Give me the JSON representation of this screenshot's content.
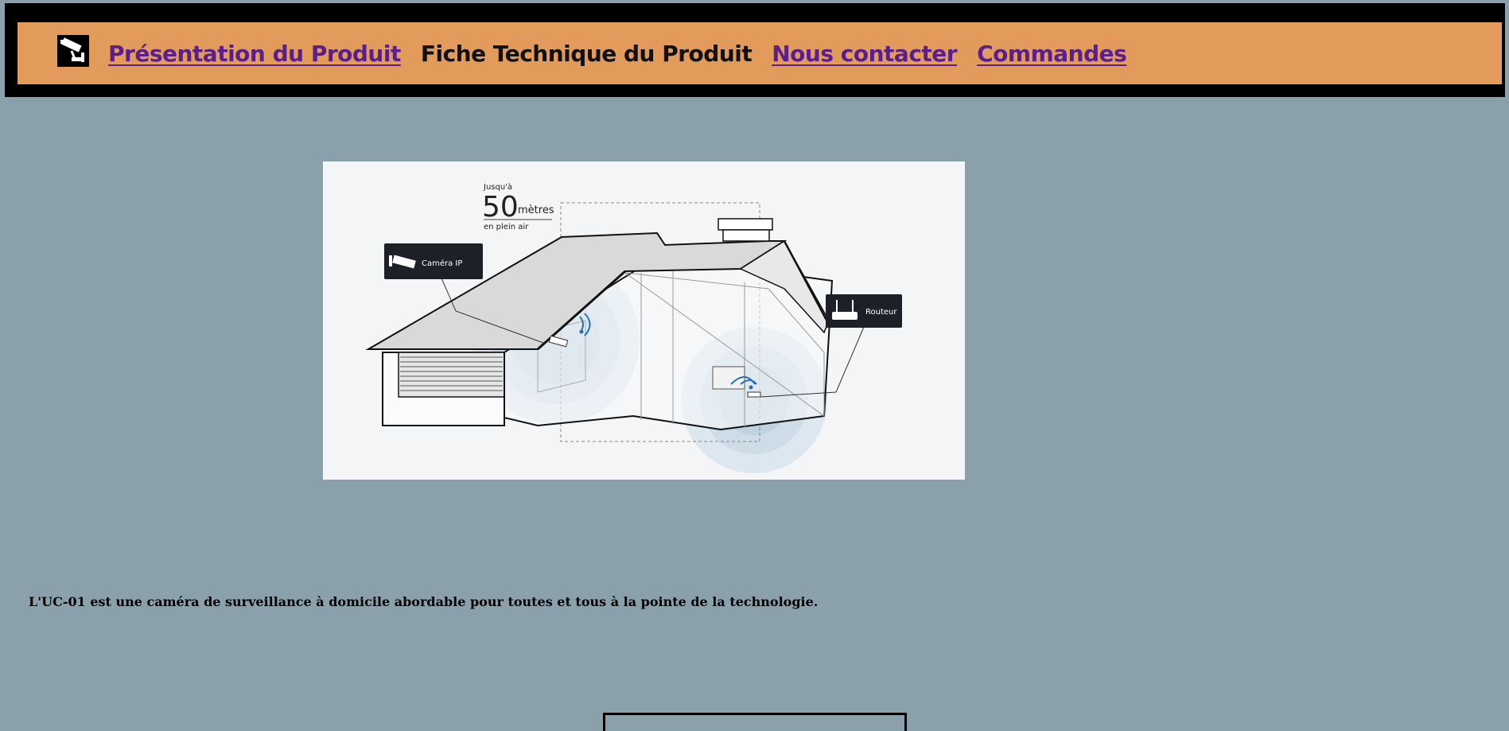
{
  "nav": {
    "links": [
      {
        "label": "Présentation du Produit",
        "current": false
      },
      {
        "label": "Fiche Technique du Produit",
        "current": true
      },
      {
        "label": "Nous contacter",
        "current": false
      },
      {
        "label": "Commandes",
        "current": false
      }
    ]
  },
  "illustration": {
    "range_prefix": "Jusqu'à",
    "range_value": "50",
    "range_unit": "mètres",
    "range_suffix": "en plein air",
    "camera_label": "Caméra IP",
    "router_label": "Routeur"
  },
  "main": {
    "tagline": "L'UC-01 est une caméra de surveillance à domicile abordable pour toutes et tous à la pointe de la technologie."
  },
  "colors": {
    "page_bg": "#8aa1ab",
    "nav_bg": "#e39b5b",
    "link": "#5a1f8c"
  }
}
